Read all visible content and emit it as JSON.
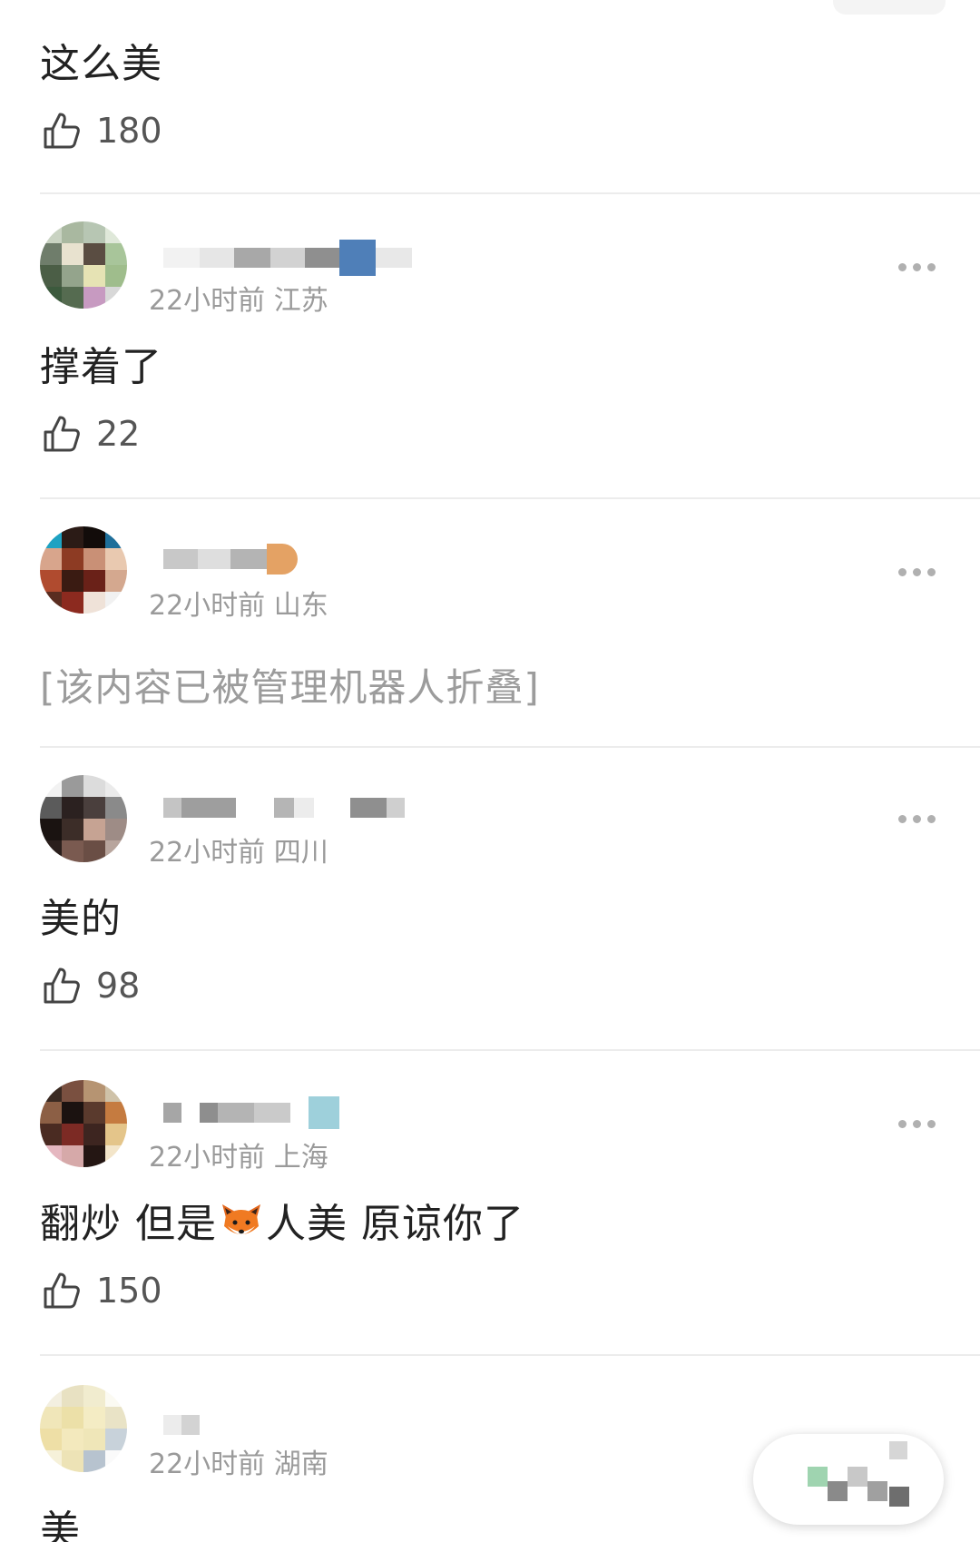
{
  "comments": [
    {
      "text": "这么美",
      "likes": "180"
    },
    {
      "meta": "22小时前 江苏",
      "text": "撑着了",
      "likes": "22"
    },
    {
      "meta": "22小时前 山东",
      "text": "[该内容已被管理机器人折叠]"
    },
    {
      "meta": "22小时前 四川",
      "text": "美的",
      "likes": "98"
    },
    {
      "meta": "22小时前 上海",
      "text_before": "翻炒 但是",
      "text_after": "人美  原谅你了",
      "likes": "150"
    },
    {
      "meta": "22小时前 湖南",
      "text": "美"
    }
  ],
  "icons": {
    "like": "thumbs-up-icon",
    "more": "more-dots-icon",
    "fox": "fox-emoji-icon"
  },
  "colors": {
    "meta": "#9a9a9a",
    "folded": "#9c9c9c",
    "divider": "#ececec"
  }
}
